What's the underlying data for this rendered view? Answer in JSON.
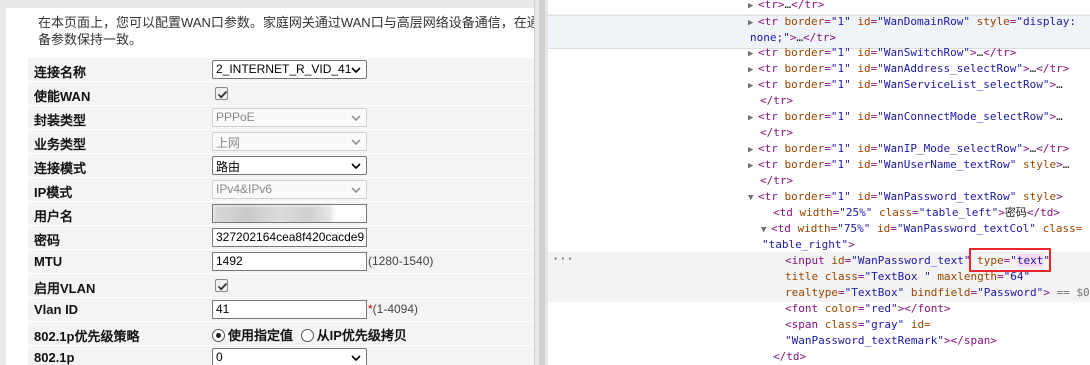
{
  "intro": {
    "line1": "在本页面上，您可以配置WAN口参数。家庭网关通过WAN口与高层网络设备通信，在通",
    "line2": "备参数保持一致。"
  },
  "form": {
    "connection_name": {
      "label": "连接名称",
      "value": "2_INTERNET_R_VID_41"
    },
    "enable_wan": {
      "label": "使能WAN",
      "checked": true
    },
    "encap_type": {
      "label": "封装类型",
      "value": "PPPoE"
    },
    "service_type": {
      "label": "业务类型",
      "value": "上网"
    },
    "conn_mode": {
      "label": "连接模式",
      "value": "路由"
    },
    "ip_mode": {
      "label": "IP模式",
      "value": "IPv4&IPv6"
    },
    "username": {
      "label": "用户名",
      "value": ""
    },
    "password": {
      "label": "密码",
      "value": "327202164cea8f420cacde9"
    },
    "mtu": {
      "label": "MTU",
      "value": "1492",
      "hint": "(1280-1540)"
    },
    "enable_vlan": {
      "label": "启用VLAN",
      "checked": true
    },
    "vlan_id": {
      "label": "Vlan ID",
      "value": "41",
      "star": "*",
      "hint": "(1-4094)"
    },
    "dot1p_policy": {
      "label": "802.1p优先级策略",
      "option1": "使用指定值",
      "option2": "从IP优先级拷贝",
      "selected": "option1"
    },
    "dot1p": {
      "label": "802.1p",
      "value": "0"
    }
  },
  "devtools": {
    "l1": {
      "t1": "<tr>",
      "tx": "…",
      "t2": "</tr>"
    },
    "l2": {
      "t1": "<tr",
      "a1": "border",
      "v1": "\"1\"",
      "a2": "id",
      "v2": "\"WanDomainRow\"",
      "a3": "style",
      "v3": "\"display:"
    },
    "l2b": {
      "v": "none;\"",
      "t": ">",
      "tx": "…",
      "t2": "</tr>"
    },
    "l3": {
      "t1": "<tr",
      "a1": "border",
      "v1": "\"1\"",
      "a2": "id",
      "v2": "\"WanSwitchRow\"",
      "t2": ">",
      "tx": "…",
      "t3": "</tr>"
    },
    "l4": {
      "t1": "<tr",
      "a1": "border",
      "v1": "\"1\"",
      "a2": "id",
      "v2": "\"WanAddress_selectRow\"",
      "t2": ">",
      "tx": "…",
      "t3": "</tr>"
    },
    "l5": {
      "t1": "<tr",
      "a1": "border",
      "v1": "\"1\"",
      "a2": "id",
      "v2": "\"WanServiceList_selectRow\"",
      "t2": ">",
      "tx": "…"
    },
    "l5b": {
      "t": "</tr>"
    },
    "l6": {
      "t1": "<tr",
      "a1": "border",
      "v1": "\"1\"",
      "a2": "id",
      "v2": "\"WanConnectMode_selectRow\"",
      "t2": ">",
      "tx": "…"
    },
    "l6b": {
      "t": "</tr>"
    },
    "l7": {
      "t1": "<tr",
      "a1": "border",
      "v1": "\"1\"",
      "a2": "id",
      "v2": "\"WanIP_Mode_selectRow\"",
      "t2": ">",
      "tx": "…",
      "t3": "</tr>"
    },
    "l8": {
      "t1": "<tr",
      "a1": "border",
      "v1": "\"1\"",
      "a2": "id",
      "v2": "\"WanUserName_textRow\"",
      "a3": "style",
      "t2": ">",
      "tx": "…"
    },
    "l8b": {
      "t": "</tr>"
    },
    "l9": {
      "t1": "<tr",
      "a1": "border",
      "v1": "\"1\"",
      "a2": "id",
      "v2": "\"WanPassword_textRow\"",
      "a3": "style",
      "t2": ">"
    },
    "l10": {
      "t1": "<td",
      "a1": "width",
      "v1": "\"25%\"",
      "a2": "class",
      "v2": "\"table_left\"",
      "t2": ">",
      "tx": "密码",
      "t3": "</td>"
    },
    "l11": {
      "t1": "<td",
      "a1": "width",
      "v1": "\"75%\"",
      "a2": "id",
      "v2": "\"WanPassword_textCol\"",
      "a3": "class="
    },
    "l11b": {
      "v": "\"table_right\"",
      "t": ">"
    },
    "l12": {
      "t1": "<input",
      "a1": "id",
      "v1": "\"WanPassword_text\"",
      "a2": "type",
      "v2q": "\"",
      "v2": "text",
      "v2e": "\""
    },
    "l13": {
      "a1": "title",
      "a2": "class",
      "v2": "\"TextBox  \"",
      "a3": "maxlength",
      "v3": "\"64\""
    },
    "l14": {
      "a1": "realtype",
      "v1": "\"TextBox\"",
      "a2": "bindfield",
      "v2": "\"Password\"",
      "t": ">",
      "eq": "== $0"
    },
    "l15": {
      "t1": "<font",
      "a1": "color",
      "v1": "\"red\"",
      "t2": "></font>"
    },
    "l16": {
      "t1": "<span",
      "a1": "class",
      "v1": "\"gray\"",
      "a2": "id="
    },
    "l16b": {
      "v": "\"WanPassword_textRemark\"",
      "t": "></span>"
    },
    "l17": {
      "t": "</td>"
    },
    "dots": "···"
  }
}
